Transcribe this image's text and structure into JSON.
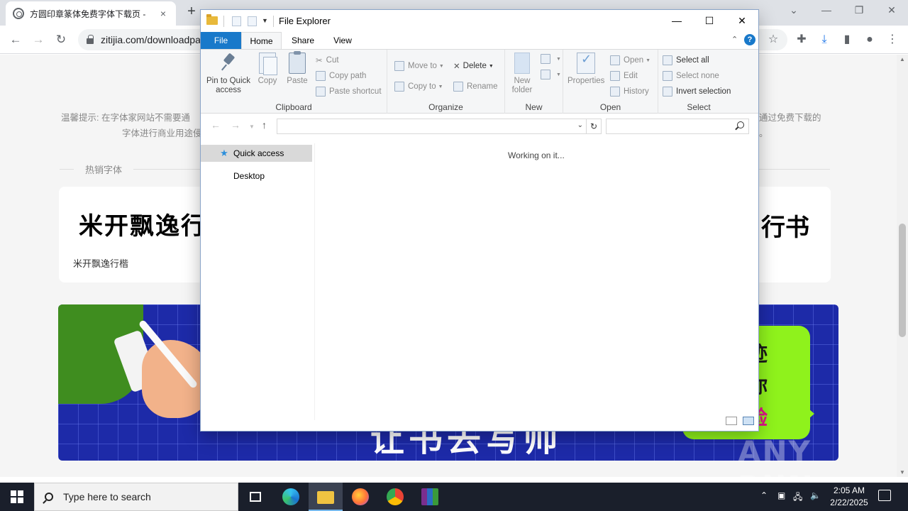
{
  "browser": {
    "tab_title": "方圆印章篆体免费字体下载页 - ",
    "tab_close": "×",
    "new_tab": "+",
    "url": "zitijia.com/downloadpage",
    "window_controls": [
      "⌄",
      "—",
      "❐",
      "✕"
    ]
  },
  "page": {
    "tip_left": "温馨提示:   在字体家网站不需要通",
    "tip_right": "通过免费下载的",
    "tip_left2": "字体进行商业用途侵",
    "tip_right2": "。",
    "hot_fonts_title": "热销字体",
    "font_card": {
      "sample_text": "米开飘逸行",
      "sample_right": "行书",
      "name": "米开飘逸行楷"
    },
    "banner": {
      "big_text": "让书去写帅",
      "green_lines": [
        "迹",
        "你",
        "验"
      ],
      "green_line_colors": [
        "#1a1a1a",
        "#1a1a1a",
        "#e0158a"
      ]
    },
    "watermark": "ANY RUN"
  },
  "explorer": {
    "title": "File Explorer",
    "controls": [
      "—",
      "☐",
      "✕"
    ],
    "tabs": [
      "File",
      "Home",
      "Share",
      "View"
    ],
    "help": "?",
    "ribbon": {
      "clipboard": {
        "label": "Clipboard",
        "pin": "Pin to Quick access",
        "copy": "Copy",
        "paste": "Paste",
        "cut": "Cut",
        "copy_path": "Copy path",
        "paste_shortcut": "Paste shortcut"
      },
      "organize": {
        "label": "Organize",
        "move_to": "Move to",
        "copy_to": "Copy to",
        "delete": "Delete",
        "rename": "Rename"
      },
      "new": {
        "label": "New",
        "new_folder": "New folder"
      },
      "open": {
        "label": "Open",
        "properties": "Properties",
        "open": "Open",
        "edit": "Edit",
        "history": "History"
      },
      "select": {
        "label": "Select",
        "select_all": "Select all",
        "select_none": "Select none",
        "invert": "Invert selection"
      }
    },
    "address_value": "",
    "search_placeholder": "",
    "nav_items": [
      "Quick access",
      "Desktop"
    ],
    "status_text": "Working on it..."
  },
  "taskbar": {
    "search_placeholder": "Type here to search",
    "time": "2:05 AM",
    "date": "2/22/2025"
  }
}
